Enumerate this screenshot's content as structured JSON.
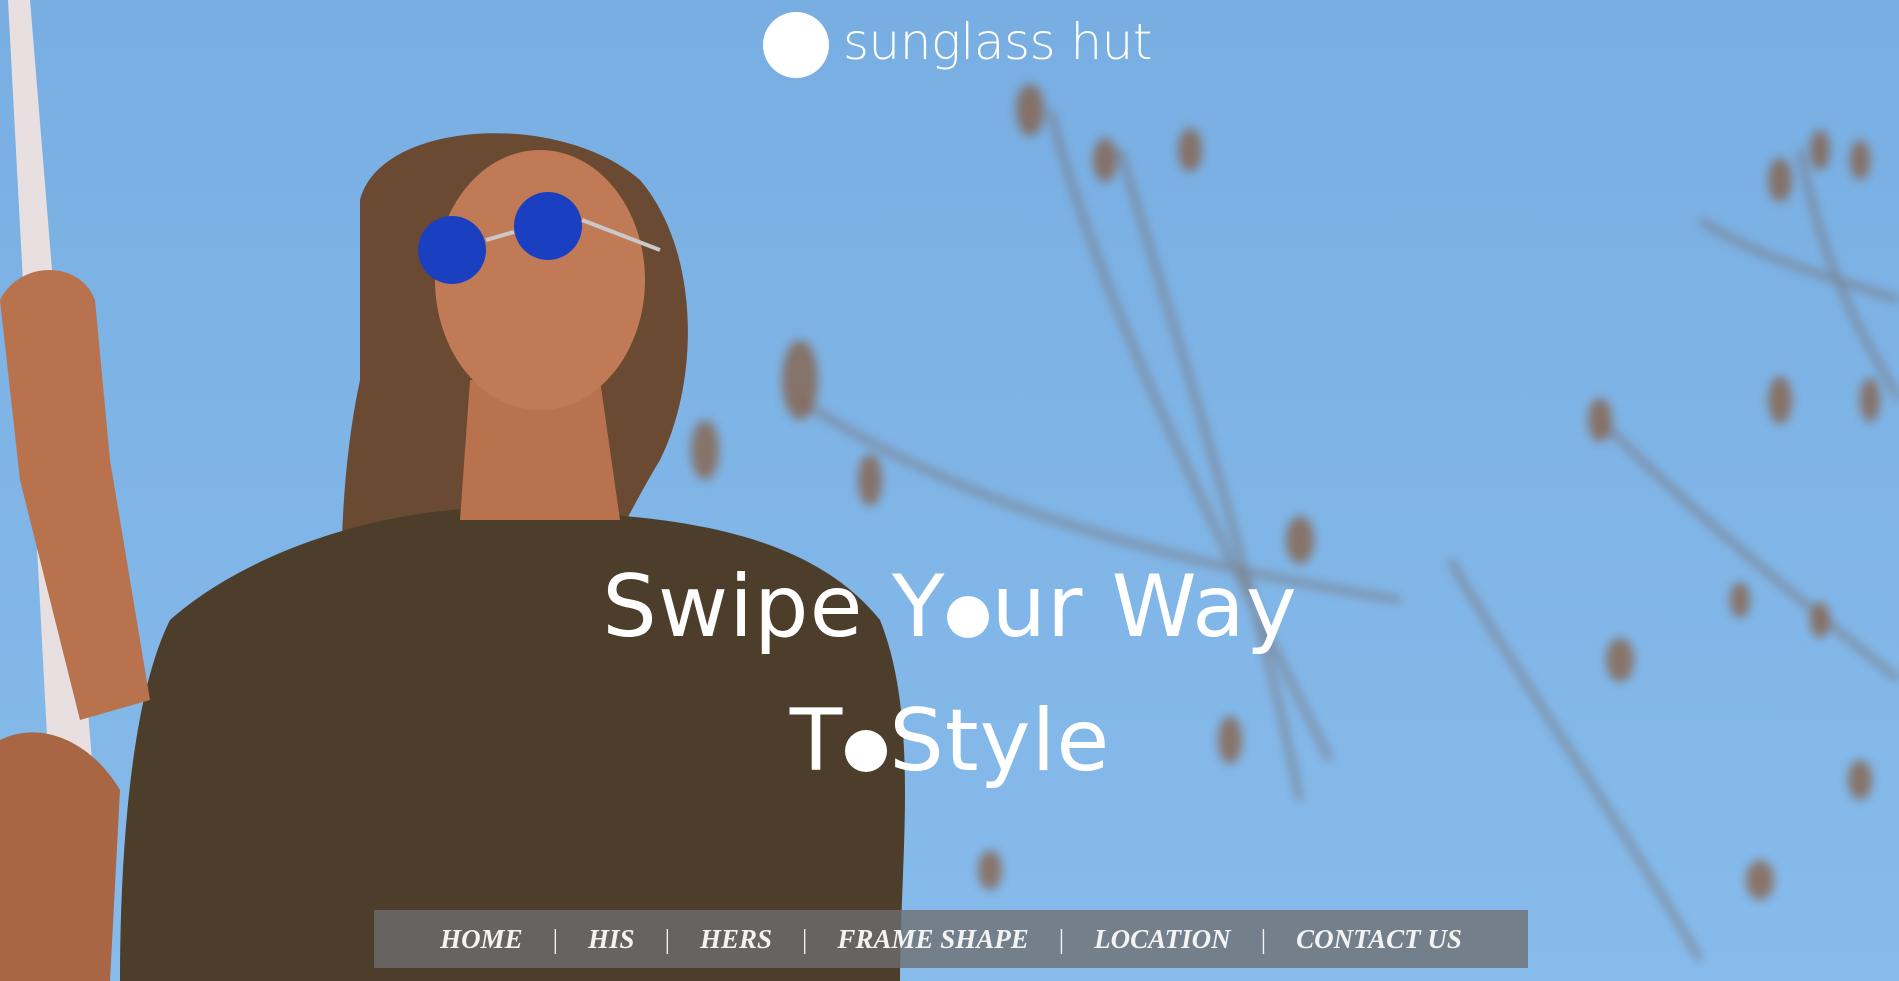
{
  "brand": {
    "name": "sunglass hut"
  },
  "hero": {
    "headline_line1_a": "Swipe Y",
    "headline_line1_b": "ur Way",
    "headline_line2_a": "T",
    "headline_line2_b": "Style"
  },
  "nav": {
    "items": [
      "HOME",
      "HIS",
      "HERS",
      "FRAME SHAPE",
      "LOCATION",
      "CONTACT US"
    ],
    "separator": "|"
  },
  "colors": {
    "sky": "#7fb4e6",
    "nav_bg": "#6e6e70",
    "text": "#ffffff"
  },
  "icons": {
    "logo_mark": "white-circle-dot"
  }
}
